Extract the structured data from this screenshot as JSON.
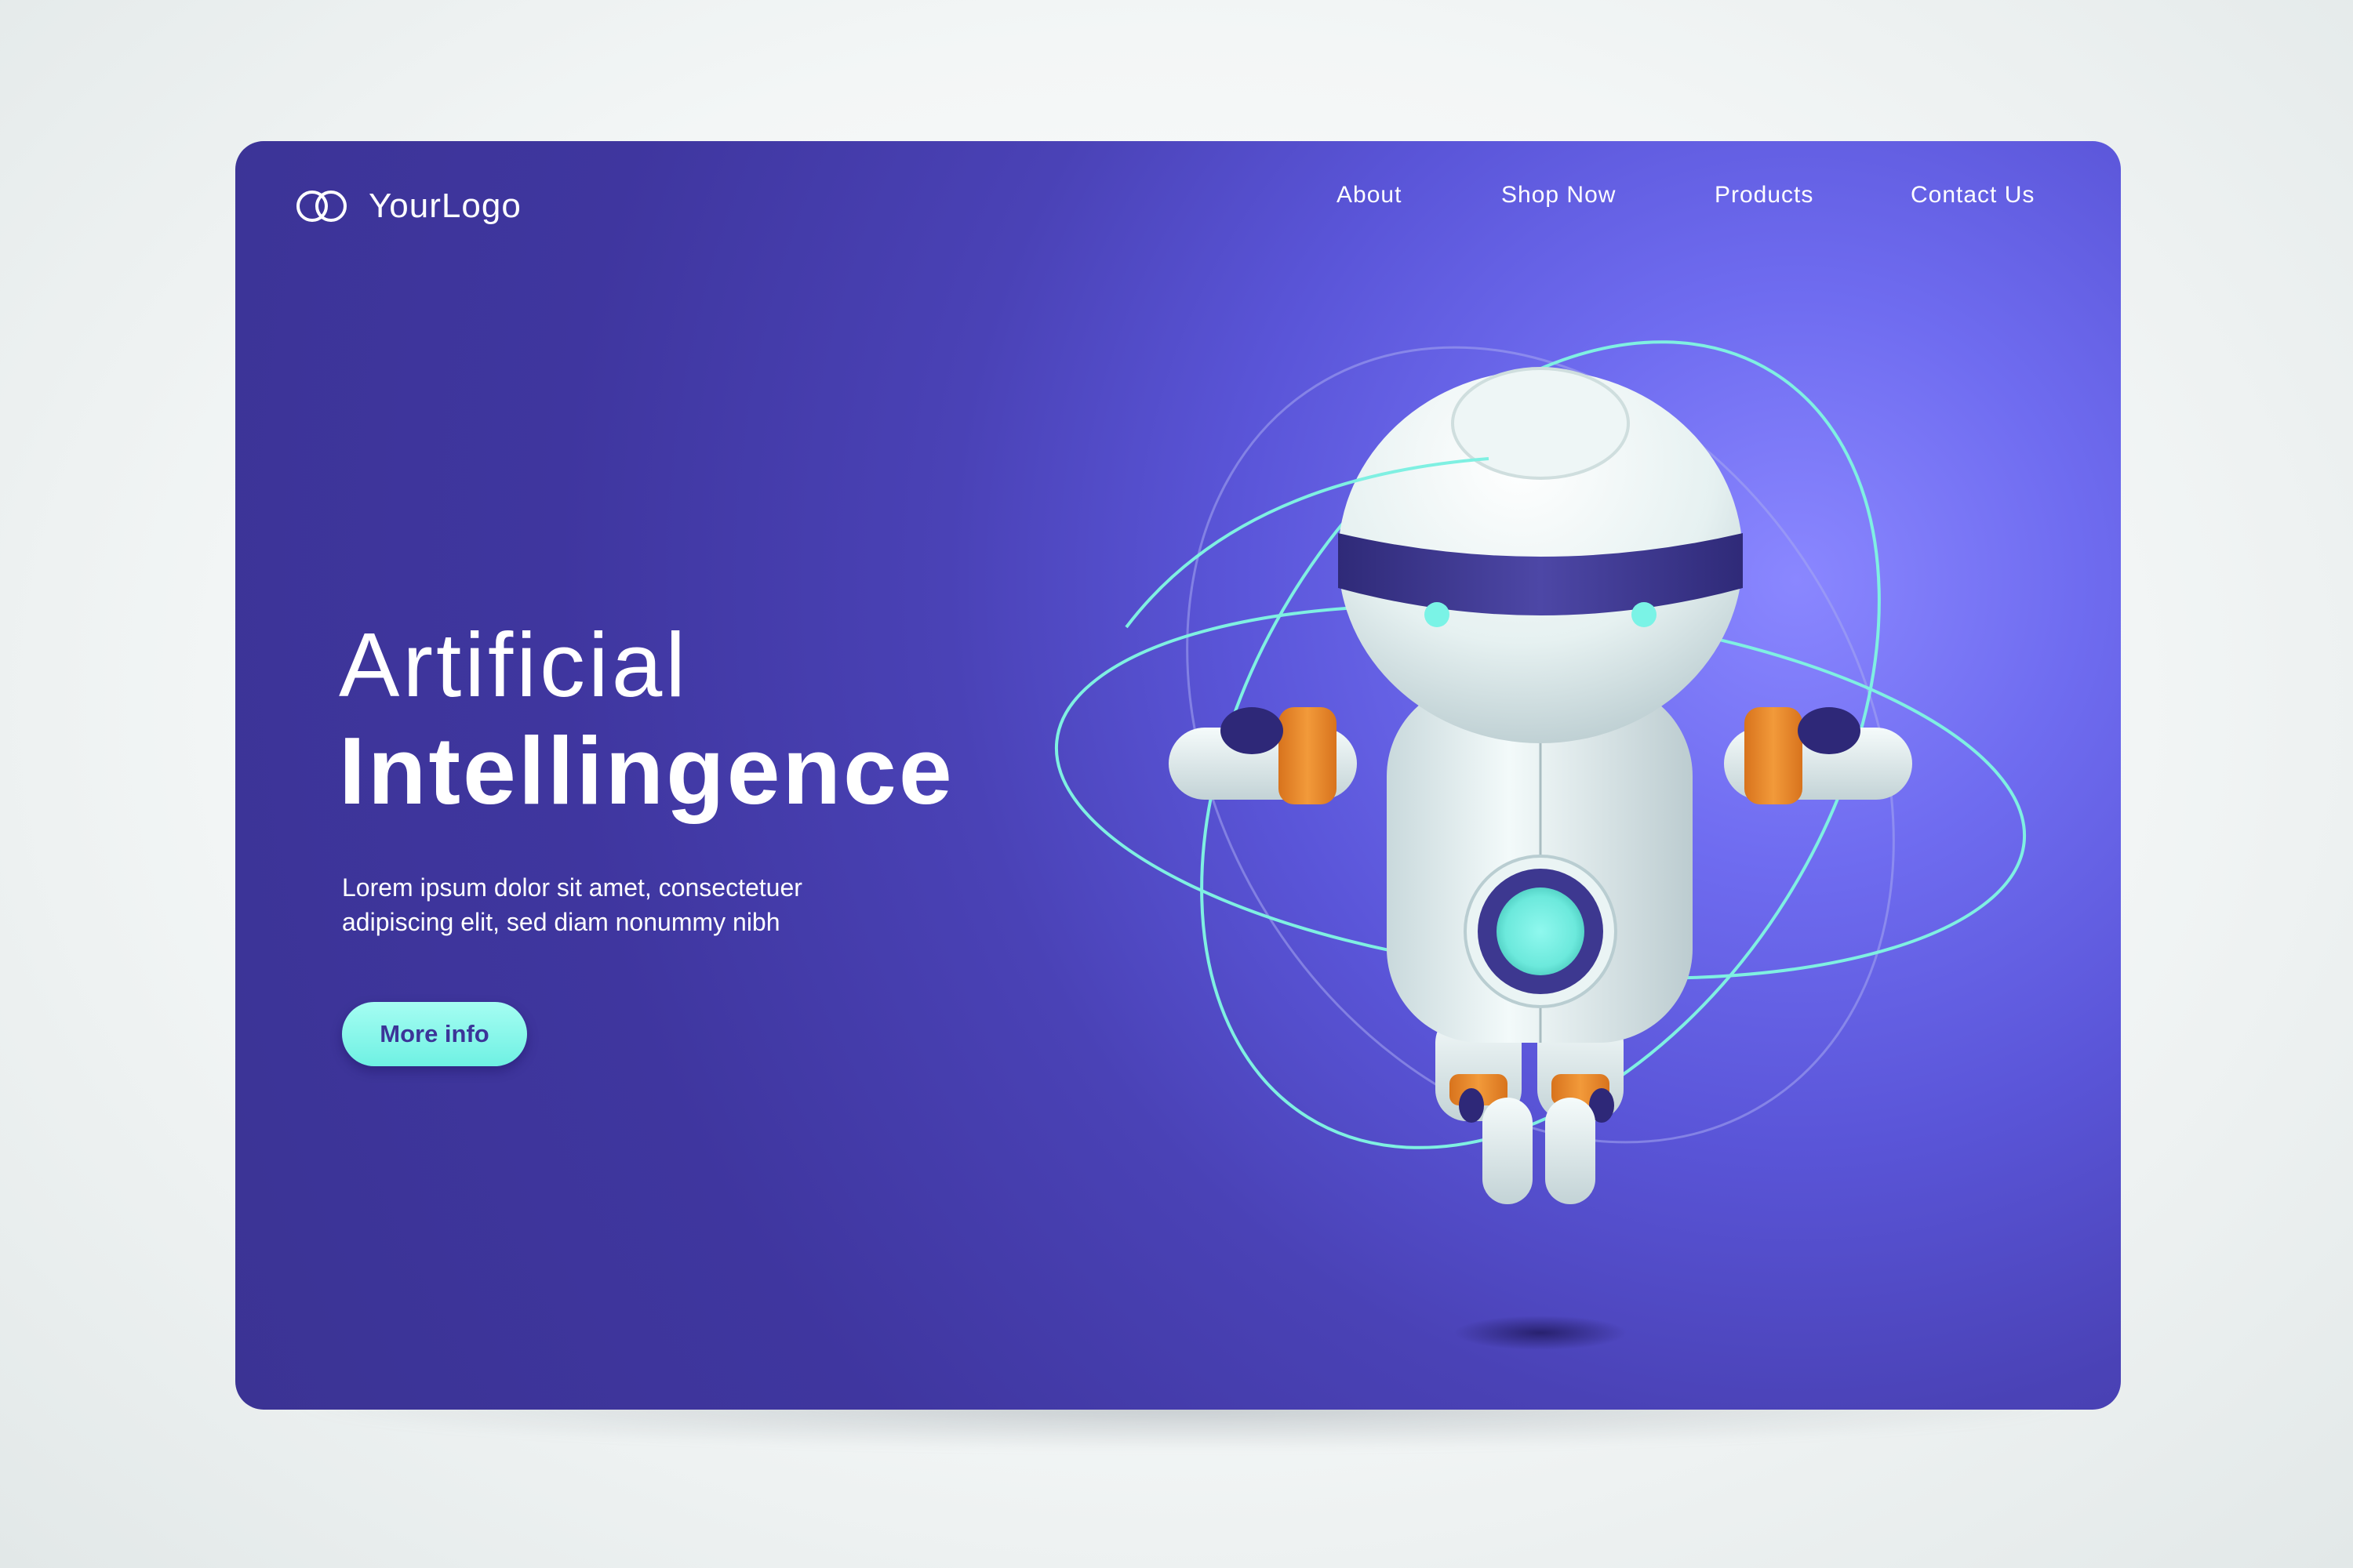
{
  "brand": {
    "logo_text": "YourLogo"
  },
  "nav": {
    "items": [
      {
        "label": "About"
      },
      {
        "label": "Shop Now"
      },
      {
        "label": "Products"
      },
      {
        "label": "Contact Us"
      }
    ]
  },
  "hero": {
    "title_line1": "Artificial",
    "title_line2": "Intellingence",
    "subtitle_line1": "Lorem ipsum dolor sit amet, consectetuer",
    "subtitle_line2": "adipiscing elit, sed diam nonummy nibh",
    "cta_label": "More info"
  },
  "colors": {
    "background_primary": "#3f369f",
    "glow": "#8a87ff",
    "accent_teal": "#7af3e6",
    "robot_body": "#e8f2f2",
    "robot_band": "#3f3a8c",
    "robot_joint": "#ee8a2a"
  },
  "icons": [
    "logo-rings-icon",
    "robot-illustration"
  ]
}
